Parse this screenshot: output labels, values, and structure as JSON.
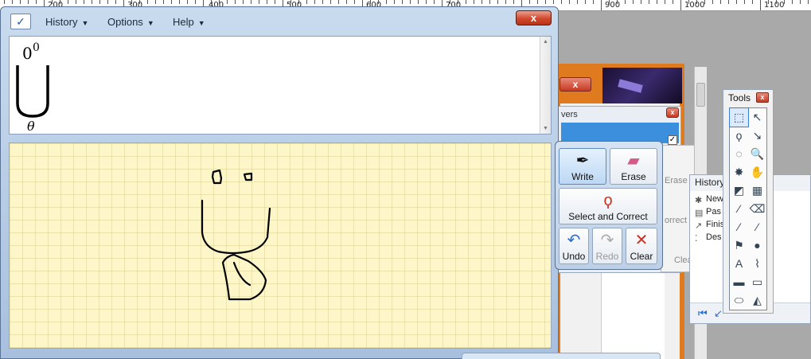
{
  "ruler": {
    "labels": [
      "200",
      "300",
      "400",
      "500",
      "600",
      "700",
      "900",
      "1000",
      "1100"
    ]
  },
  "background": {
    "layers_title": "vers",
    "history_panel": {
      "title": "History",
      "items": [
        "New",
        "Pas",
        "Finis",
        "Des"
      ]
    },
    "palette_partial": {
      "erase_label": "Erase",
      "correct_label": "orrect",
      "clear_label": "Clear"
    },
    "tools_panel": {
      "title": "Tools",
      "close_label": "x",
      "icons": [
        "rect-select-icon",
        "move-selection-icon",
        "lasso-icon",
        "move-pixels-icon",
        "ellipse-select-icon",
        "zoom-icon",
        "magic-wand-icon",
        "pan-icon",
        "paint-bucket-icon",
        "gradient-icon",
        "paintbrush-icon",
        "eraser-icon",
        "pencil-icon",
        "color-picker-icon",
        "clone-stamp-icon",
        "recolor-icon",
        "text-icon",
        "line-curve-icon",
        "rectangle-icon",
        "rounded-rectangle-icon",
        "ellipse-icon",
        "freeform-shape-icon"
      ],
      "glyphs": [
        "⬚",
        "↖",
        "ϙ",
        "↘",
        "◌",
        "🔍",
        "✸",
        "✋",
        "◩",
        "▦",
        "⁄",
        "⌫",
        "∕",
        "⁄",
        "⚑",
        "●",
        "A",
        "⌇",
        "▬",
        "▭",
        "⬭",
        "◭"
      ]
    }
  },
  "window": {
    "title_close": "x",
    "menu": {
      "history": "History",
      "options": "Options",
      "help": "Help"
    }
  },
  "preview": {
    "superscript": "0",
    "base": "0",
    "subscript": "θ"
  },
  "tools": {
    "write": "Write",
    "erase": "Erase",
    "select_correct": "Select and Correct",
    "undo": "Undo",
    "redo": "Redo",
    "clear": "Clear"
  },
  "colors": {
    "ink": "#000000",
    "canvas_bg": "#fdf6c8",
    "close_red": "#d2492c",
    "frame_blue": "#b5cbe4"
  }
}
